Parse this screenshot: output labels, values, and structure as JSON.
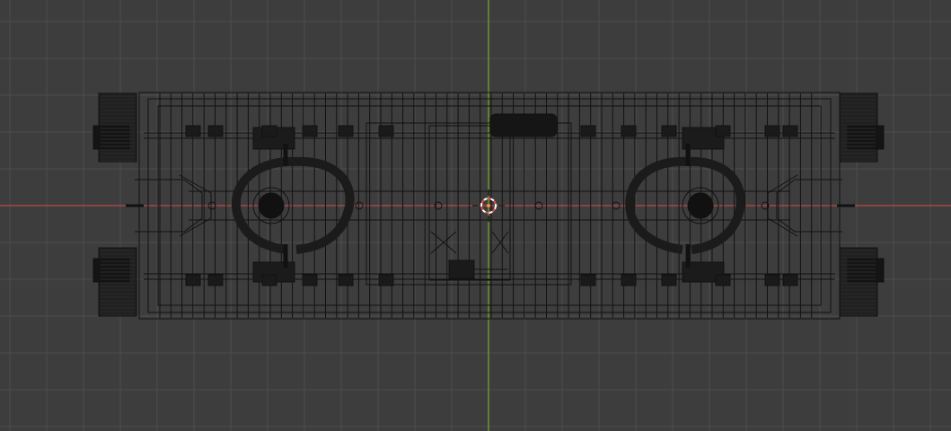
{
  "viewport": {
    "view": "top-orthographic",
    "shading": "wireframe",
    "object": "railway-wagon-chassis"
  },
  "colors": {
    "background": "#3d3d3d",
    "grid_minor": "#454545",
    "grid_major": "#4d4d4d",
    "x_axis": "#b74a4a",
    "y_axis": "#7ea52a",
    "wire": "#111111",
    "wire_light": "#2a2a2a",
    "cursor_red": "#e05050",
    "cursor_white": "#ffffff"
  },
  "icons": {
    "cursor": "3d-cursor-icon"
  }
}
